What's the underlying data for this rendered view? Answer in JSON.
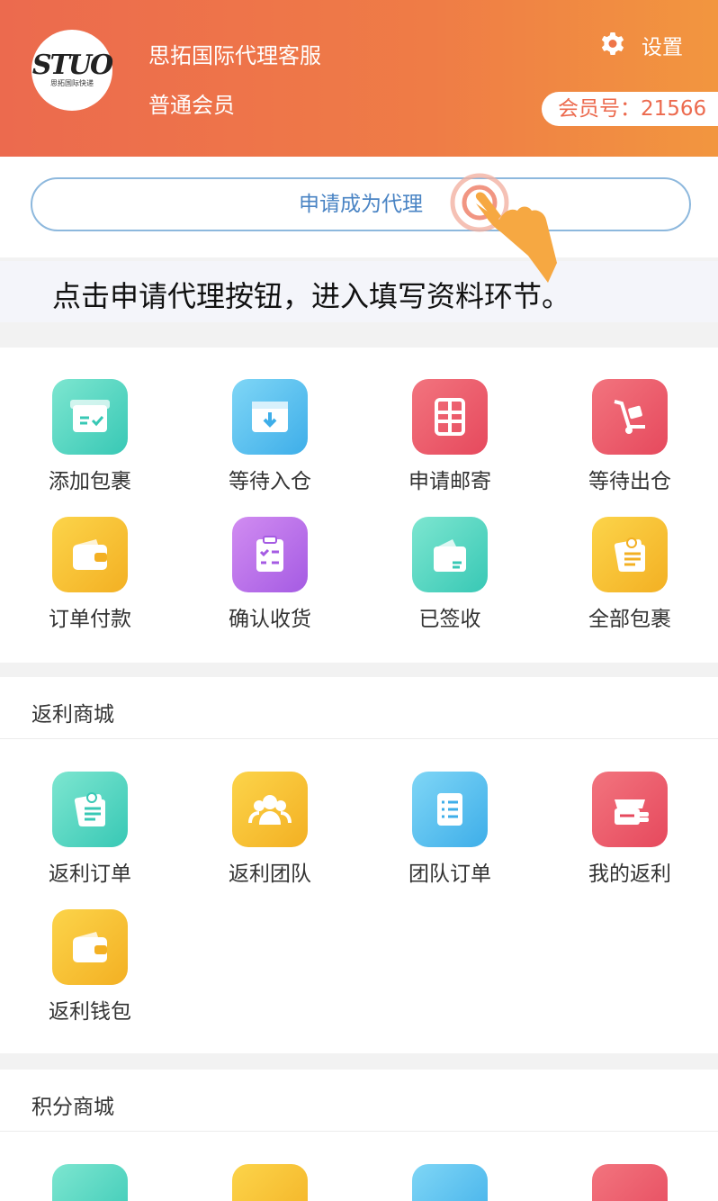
{
  "header": {
    "logo_text": "STUO",
    "logo_sub": "思拓国际快递",
    "name": "思拓国际代理客服",
    "level": "普通会员",
    "settings_label": "设置",
    "member_no": "会员号：21566"
  },
  "apply": {
    "button_label": "申请成为代理",
    "tip": "点击申请代理按钮，进入填写资料环节。"
  },
  "orders_grid": {
    "items": [
      {
        "label": "添加包裹",
        "icon": "add-package-icon",
        "color": "#38c8b5"
      },
      {
        "label": "等待入仓",
        "icon": "inbox-download-icon",
        "color": "#3eaee9"
      },
      {
        "label": "申请邮寄",
        "icon": "parcel-mail-icon",
        "color": "#e6495d"
      },
      {
        "label": "等待出仓",
        "icon": "hand-truck-icon",
        "color": "#e6495d"
      },
      {
        "label": "订单付款",
        "icon": "wallet-icon",
        "color": "#f3b023"
      },
      {
        "label": "确认收货",
        "icon": "clipboard-check-icon",
        "color": "#a55be3"
      },
      {
        "label": "已签收",
        "icon": "signed-folder-icon",
        "color": "#38c8b5"
      },
      {
        "label": "全部包裹",
        "icon": "notes-icon",
        "color": "#f3b023"
      }
    ]
  },
  "rebate_mall": {
    "title": "返利商城",
    "items": [
      {
        "label": "返利订单",
        "icon": "notes-icon",
        "color": "#38c8b5"
      },
      {
        "label": "返利团队",
        "icon": "team-icon",
        "color": "#f3b023"
      },
      {
        "label": "团队订单",
        "icon": "checklist-icon",
        "color": "#3eaee9"
      },
      {
        "label": "我的返利",
        "icon": "cash-register-icon",
        "color": "#e6495d"
      },
      {
        "label": "返利钱包",
        "icon": "wallet-icon",
        "color": "#f3b023"
      }
    ]
  },
  "points_mall": {
    "title": "积分商城"
  }
}
